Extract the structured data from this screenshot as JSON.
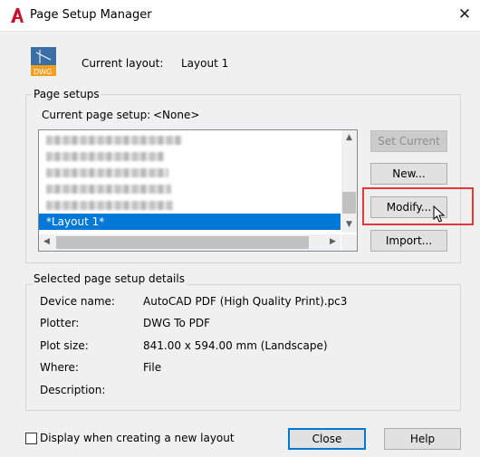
{
  "window": {
    "title": "Page Setup Manager",
    "close_glyph": "✕"
  },
  "current_layout": {
    "label": "Current layout:",
    "value": "Layout 1",
    "icon_text": "DWG"
  },
  "page_setups": {
    "group_label": "Page setups",
    "current_label": "Current page setup:",
    "current_value": "<None>",
    "items": [
      {
        "label": "*Layout 1*",
        "selected": true
      }
    ],
    "buttons": {
      "set_current": "Set Current",
      "new": "New...",
      "modify": "Modify...",
      "import": "Import..."
    }
  },
  "details": {
    "group_label": "Selected page setup details",
    "device_name_label": "Device name:",
    "device_name_value": "AutoCAD PDF (High Quality Print).pc3",
    "plotter_label": "Plotter:",
    "plotter_value": "DWG To PDF",
    "plot_size_label": "Plot size:",
    "plot_size_value": "841.00 x 594.00 mm (Landscape)",
    "where_label": "Where:",
    "where_value": "File",
    "description_label": "Description:",
    "description_value": ""
  },
  "footer": {
    "checkbox_label": "Display when creating a new layout",
    "checkbox_checked": false,
    "close": "Close",
    "help": "Help"
  },
  "colors": {
    "accent": "#0078d7",
    "highlight": "#e53935",
    "app_logo": "#c8102e"
  }
}
